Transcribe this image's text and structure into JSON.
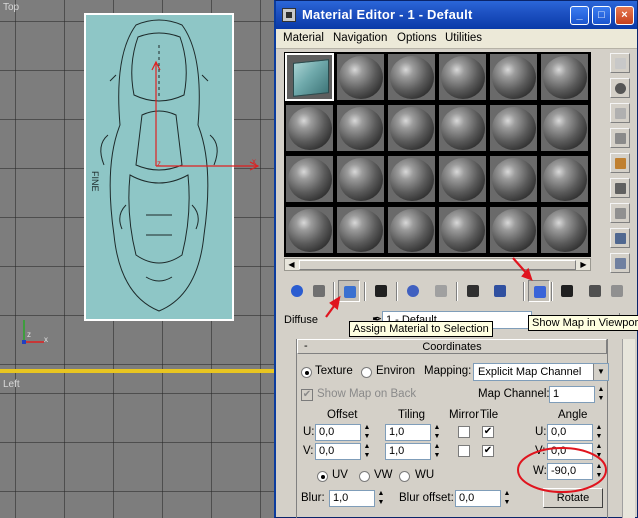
{
  "viewports": {
    "top_label": "Top",
    "left_label": "Left",
    "axis_x_label": "x",
    "axis_z_label": "z",
    "plane_text": "FINE"
  },
  "window": {
    "title": "Material Editor - 1 - Default",
    "minimize": "_",
    "maximize": "□",
    "close": "×"
  },
  "menu": [
    "Material",
    "Navigation",
    "Options",
    "Utilities"
  ],
  "slots": {
    "rows": 4,
    "cols": 6,
    "active_index": 0
  },
  "toolbar_icons": [
    "get-material-icon",
    "put-to-scene-icon",
    "assign-material-icon",
    "reset-map-icon",
    "make-unique-icon",
    "make-preview-icon",
    "put-to-library-icon",
    "material-id-icon",
    "show-map-in-viewport-icon",
    "show-end-result-icon",
    "go-to-parent-icon",
    "go-forward-icon"
  ],
  "side_icons": [
    "sample-type-icon",
    "backlight-icon",
    "background-icon",
    "uv-tiling-icon",
    "video-check-icon",
    "make-preview-icon",
    "options-icon",
    "select-by-material-icon",
    "material-navigator-icon"
  ],
  "tooltips": {
    "assign": "Assign Material to Selection",
    "show_map": "Show Map in Viewport"
  },
  "diffuse_label": "Diffuse",
  "material_name": "1 - Default",
  "coordinates": {
    "header": "Coordinates",
    "collapse": "-",
    "texture_label": "Texture",
    "environ_label": "Environ",
    "mapping_label": "Mapping:",
    "mapping_value": "Explicit Map Channel",
    "show_map_on_back": "Show Map on Back",
    "map_channel_label": "Map Channel:",
    "map_channel_value": "1",
    "offset_header": "Offset",
    "tiling_header": "Tiling",
    "mirror_header": "Mirror",
    "tile_header": "Tile",
    "angle_header": "Angle",
    "u_label": "U:",
    "v_label": "V:",
    "w_label": "W:",
    "u_offset": "0,0",
    "v_offset": "0,0",
    "u_tiling": "1,0",
    "v_tiling": "1,0",
    "u_angle": "0,0",
    "v_angle": "0,0",
    "w_angle": "-90,0",
    "uv_label": "UV",
    "vw_label": "VW",
    "wu_label": "WU",
    "blur_label": "Blur:",
    "blur_value": "1,0",
    "blur_offset_label": "Blur offset:",
    "blur_offset_value": "0,0",
    "rotate_label": "Rotate"
  },
  "colors": {
    "annotation_red": "#e0141e",
    "titlebar_blue": "#1e52c3",
    "plane_cyan": "#8ec6c6",
    "viewport_active": "#e8c520"
  }
}
